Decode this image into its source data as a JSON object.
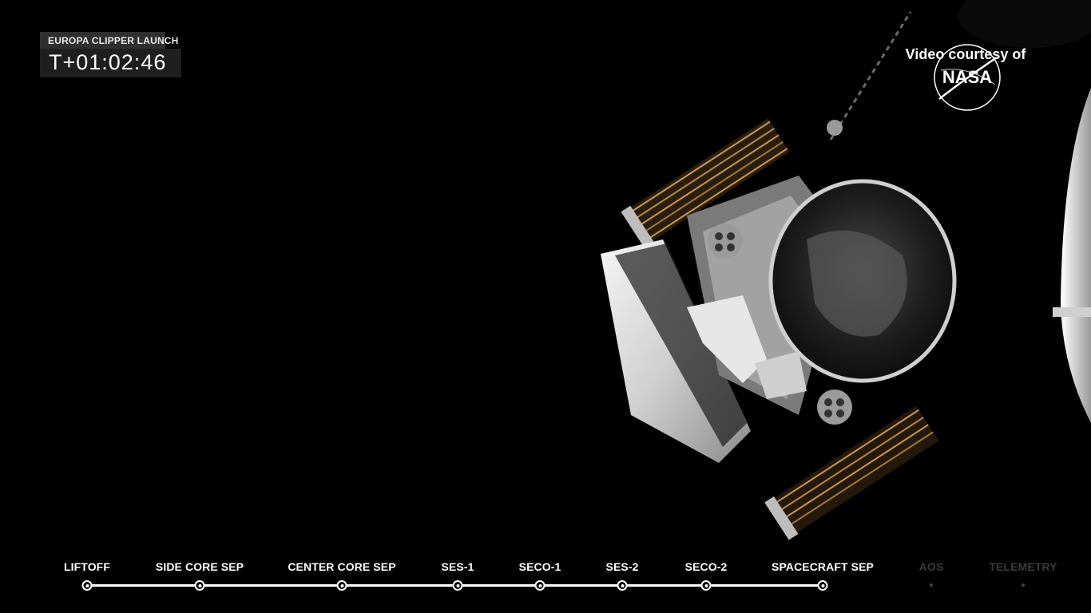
{
  "overlay": {
    "mission_name": "EUROPA CLIPPER LAUNCH",
    "mission_time": "T+01:02:46",
    "courtesy_text": "Video courtesy of",
    "courtesy_logo": "NASA"
  },
  "timeline": {
    "milestones": [
      {
        "label": "LIFTOFF",
        "state": "complete"
      },
      {
        "label": "SIDE CORE SEP",
        "state": "complete"
      },
      {
        "label": "CENTER CORE SEP",
        "state": "complete"
      },
      {
        "label": "SES-1",
        "state": "complete"
      },
      {
        "label": "SECO-1",
        "state": "complete"
      },
      {
        "label": "SES-2",
        "state": "complete"
      },
      {
        "label": "SECO-2",
        "state": "complete"
      },
      {
        "label": "SPACECRAFT SEP",
        "state": "complete"
      },
      {
        "label": "AOS",
        "state": "pending"
      },
      {
        "label": "TELEMETRY",
        "state": "pending"
      }
    ]
  },
  "colors": {
    "background": "#000000",
    "active": "#ffffff",
    "pending": "#3a3a3a"
  }
}
